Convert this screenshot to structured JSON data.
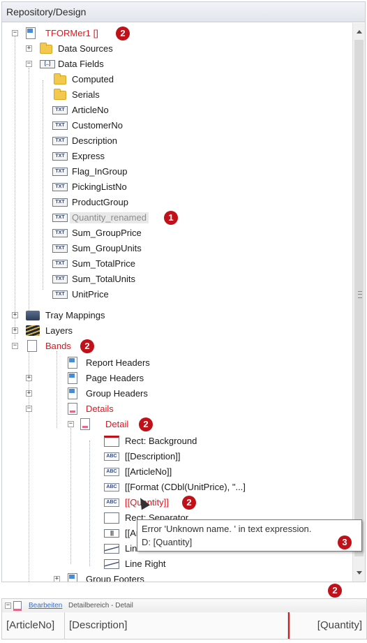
{
  "panel": {
    "title": "Repository/Design"
  },
  "tree": {
    "root": {
      "label": "TFORMer1 []",
      "badge": "2"
    },
    "data_sources": "Data Sources",
    "data_fields": "Data Fields",
    "fields": [
      "Computed",
      "Serials",
      "ArticleNo",
      "CustomerNo",
      "Description",
      "Express",
      "Flag_InGroup",
      "PickingListNo",
      "ProductGroup",
      "Quantity_renamed",
      "Sum_GroupPrice",
      "Sum_GroupUnits",
      "Sum_TotalPrice",
      "Sum_TotalUnits",
      "UnitPrice"
    ],
    "renamed_badge": "1",
    "tray_mappings": "Tray Mappings",
    "layers": "Layers",
    "bands": {
      "label": "Bands",
      "badge": "2"
    },
    "report_headers": "Report Headers",
    "page_headers": "Page Headers",
    "group_headers": "Group Headers",
    "details": "Details",
    "detail": {
      "label": "Detail",
      "badge": "2"
    },
    "detail_items": [
      "Rect: Background",
      "[[Description]]",
      "[[ArticleNo]]",
      "[[Format (CDbl(UnitPrice), \"...]",
      "[[Quantity]]",
      "Rect: Separator",
      "[[Ar",
      "Line Left",
      "Line Right"
    ],
    "quantity_badge": "2",
    "group_footers": "Group Footers",
    "expander_plus": "+",
    "expander_minus": "−",
    "icon_text_label": "TXT",
    "icon_abc_label": "ABC",
    "icon_barcode_label": "||||"
  },
  "tooltip": {
    "line1": "Error 'Unknown name. ' in text expression.",
    "line2": "D: [Quantity]",
    "badge": "3"
  },
  "bottom": {
    "link": "Bearbeiten",
    "caption": "Detailbereich - Detail",
    "badge": "2",
    "cells": [
      "[ArticleNo]",
      "[Description]",
      "[Quantity]"
    ]
  }
}
